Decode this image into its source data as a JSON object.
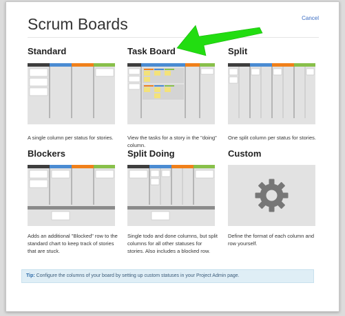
{
  "dialog": {
    "title": "Scrum Boards",
    "cancel_label": "Cancel"
  },
  "colors": {
    "col1": "#3d3d3d",
    "col2": "#4a8bd2",
    "col3": "#f0801a",
    "col4": "#88c04a",
    "thumb_bg": "#e2e2e2",
    "arrow": "#22dd11",
    "tip_bg": "#dfeef6"
  },
  "options": [
    {
      "name": "Standard",
      "description": "A single column per status for stories."
    },
    {
      "name": "Task Board",
      "description": "View the tasks for a story in the \"doing\" column."
    },
    {
      "name": "Split",
      "description": "One split column per status for stories."
    },
    {
      "name": "Blockers",
      "description": "Adds an additional \"Blocked\" row to the standard chart to keep track of stories that are stuck."
    },
    {
      "name": "Split Doing",
      "description": "Single todo and done columns, but split columns for all other statuses for stories. Also includes a blocked row."
    },
    {
      "name": "Custom",
      "description": "Define the format of each column and row yourself."
    }
  ],
  "tip": {
    "label": "Tip:",
    "text": "Configure the columns of your board by setting up custom statuses in your Project Admin page."
  },
  "icons": {
    "custom": "gear-icon",
    "annotation": "arrow-icon"
  }
}
